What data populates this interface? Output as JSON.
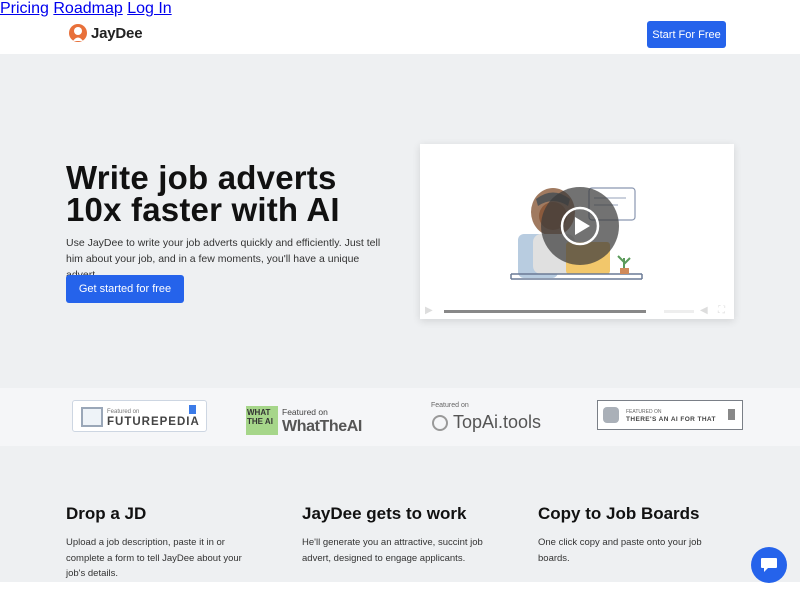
{
  "brand": {
    "name": "JayDee"
  },
  "nav": {
    "links": [
      "Pricing",
      "Roadmap",
      "Log In"
    ],
    "cta": "Start For Free"
  },
  "hero": {
    "title_line1": "Write job adverts",
    "title_line2": "10x faster with AI",
    "subtitle": "Use JayDee to write your job adverts quickly and efficiently. Just tell him about your job, and in a few moments, you'll have a unique advert.",
    "cta": "Get started for free"
  },
  "video": {
    "progress": 0.0,
    "icons": [
      "play-icon",
      "volume-icon",
      "fullscreen-icon"
    ]
  },
  "featured": [
    {
      "small": "Featured on",
      "big": "FUTUREPEDIA"
    },
    {
      "small": "Featured on",
      "big": "WhatTheAI",
      "square": "WHAT THE AI"
    },
    {
      "small": "Featured on",
      "big": "TopAi.tools"
    },
    {
      "small": "FEATURED ON",
      "big": "THERE'S AN AI FOR THAT"
    }
  ],
  "steps": [
    {
      "title": "Drop a JD",
      "text": "Upload a job description, paste it in or complete a form to tell JayDee about your job's details."
    },
    {
      "title": "JayDee gets to work",
      "text": "He'll generate you an attractive, succint job advert, designed to engage applicants."
    },
    {
      "title": "Copy to Job Boards",
      "text": "One click copy and paste onto your job boards."
    }
  ],
  "colors": {
    "primary": "#2563eb",
    "hero_bg": "#eef0f2",
    "logo_accent": "#e8703a"
  }
}
